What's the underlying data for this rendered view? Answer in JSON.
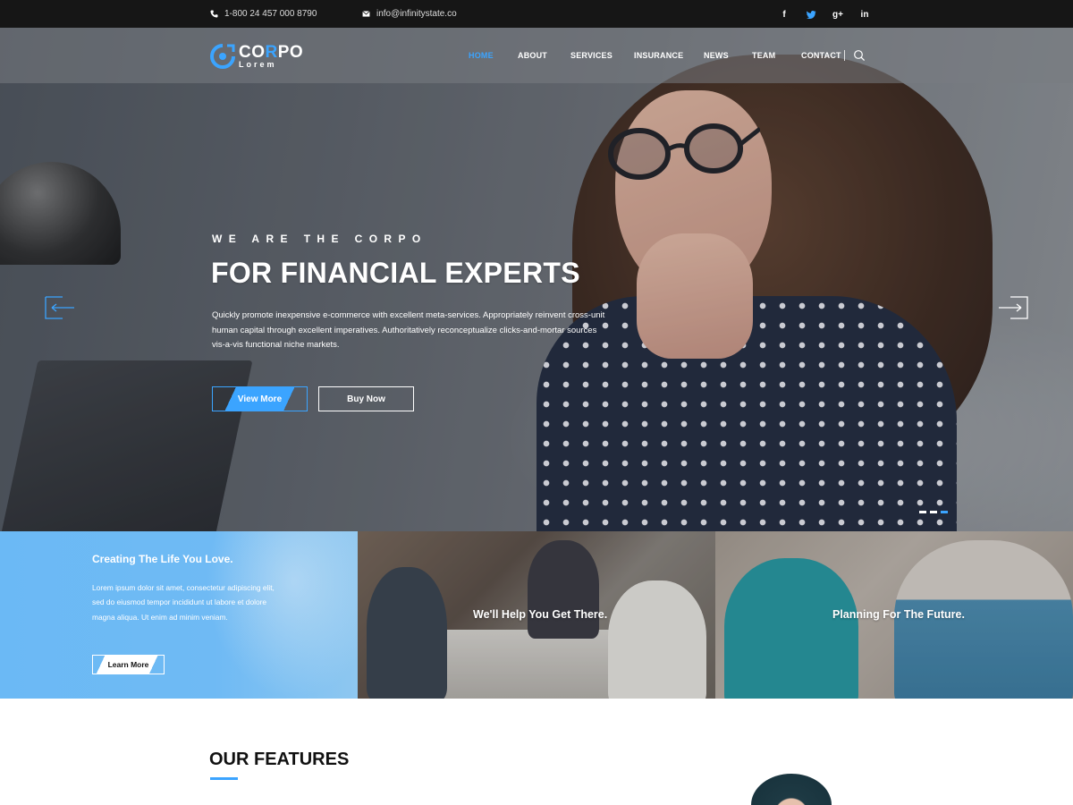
{
  "topbar": {
    "phone": "1-800 24 457 000 8790",
    "email": "info@infinitystate.co",
    "socials": [
      {
        "icon": "facebook-icon",
        "glyph": "f"
      },
      {
        "icon": "twitter-icon",
        "glyph": "🐦"
      },
      {
        "icon": "google-plus-icon",
        "glyph": "g+"
      },
      {
        "icon": "linkedin-icon",
        "glyph": "in"
      }
    ]
  },
  "logo": {
    "name_prefix": "CO",
    "name_highlight": "R",
    "name_suffix": "PO",
    "sub": "Lorem"
  },
  "nav": {
    "items": [
      "HOME",
      "ABOUT",
      "SERVICES",
      "INSURANCE",
      "NEWS",
      "TEAM",
      "CONTACT"
    ],
    "active": "HOME"
  },
  "hero": {
    "eyebrow": "WE ARE THE CORPO",
    "headline": "FOR FINANCIAL EXPERTS",
    "lead": "Quickly promote inexpensive e-commerce with excellent meta-services. Appropriately reinvent cross-unit human capital through excellent imperatives. Authoritatively reconceptualize clicks-and-mortar sources vis-a-vis functional niche markets.",
    "primary_button": "View More",
    "secondary_button": "Buy Now",
    "slides": 3,
    "active_slide": 3
  },
  "panels": [
    {
      "title": "Creating The Life You Love.",
      "text": "Lorem ipsum dolor sit amet, consectetur adipiscing elit, sed do eiusmod tempor incididunt ut labore et dolore magna aliqua. Ut enim ad minim veniam.",
      "button": "Learn More"
    },
    {
      "caption": "We'll Help You Get There."
    },
    {
      "caption": "Planning For The Future."
    }
  ],
  "features": {
    "title": "OUR FEATURES"
  },
  "colors": {
    "accent": "#3ba4ff",
    "topbar": "#161616",
    "panel_blue": "#6fbaf4"
  }
}
